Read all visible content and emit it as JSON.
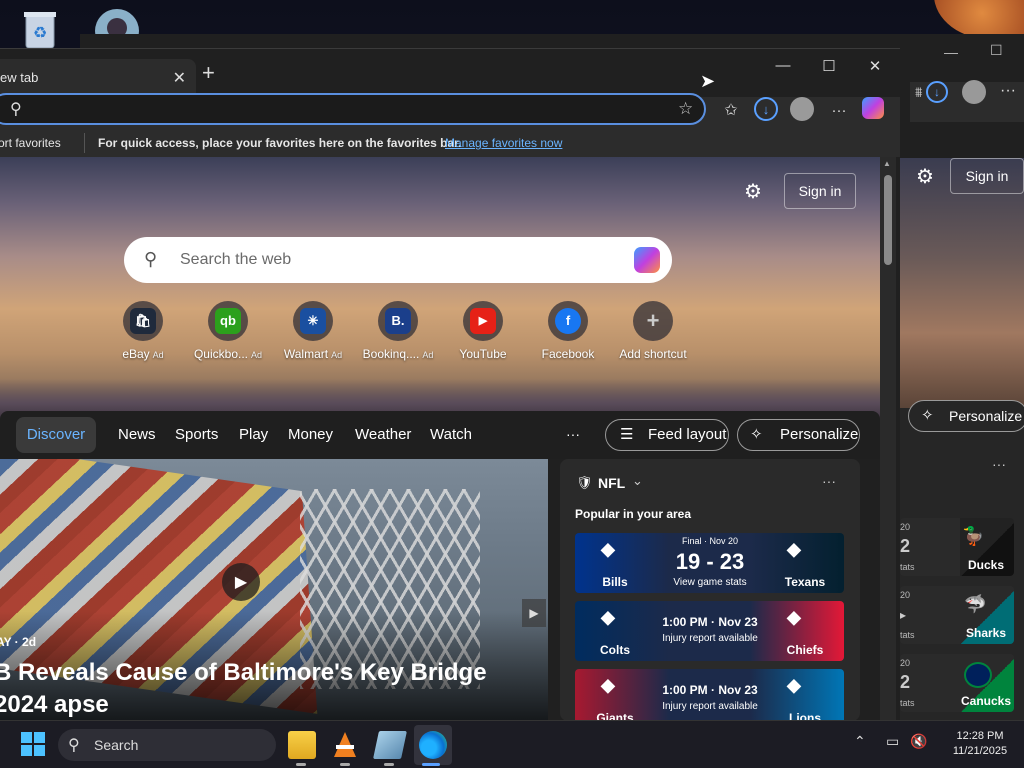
{
  "desktop": {
    "icons": [
      "recycle-bin-icon",
      "user-avatar-icon"
    ]
  },
  "background_window": {
    "signin_label": "Sign in",
    "personalize_label": "Personalize",
    "games": [
      {
        "team": "Ducks",
        "partial_top": "20",
        "partial_mid": "2",
        "partial_bottom": "tats"
      },
      {
        "team": "Sharks",
        "partial_top": "20",
        "partial_mid": "▸",
        "partial_bottom": "tats"
      },
      {
        "team": "Canucks",
        "partial_top": "20",
        "partial_mid": "2",
        "partial_bottom": "tats"
      }
    ]
  },
  "browser": {
    "tab_title": "ew tab",
    "fav_left": "ort favorites",
    "favbar_message": "For quick access, place your favorites here on the favorites bar.",
    "favbar_link": "Manage favorites now",
    "address_value": "",
    "window_controls": {
      "minimize": "—",
      "maximize": "☐",
      "close": "✕"
    }
  },
  "hero": {
    "signin_label": "Sign in",
    "search_placeholder": "Search the web"
  },
  "shortcuts": [
    {
      "label": "eBay",
      "ad": "Ad",
      "icon": "ebay-icon",
      "glyph": "🛍",
      "color": "#1f2a3c"
    },
    {
      "label": "Quickbo...",
      "ad": "Ad",
      "icon": "quickbooks-icon",
      "glyph": "qb",
      "color": "#2ca01c"
    },
    {
      "label": "Walmart",
      "ad": "Ad",
      "icon": "walmart-icon",
      "glyph": "✳",
      "color": "#1a4fa0"
    },
    {
      "label": "Bookinq....",
      "ad": "Ad",
      "icon": "booking-icon",
      "glyph": "B.",
      "color": "#1b3f8b"
    },
    {
      "label": "YouTube",
      "ad": "",
      "icon": "youtube-icon",
      "glyph": "▶",
      "color": "#e62117"
    },
    {
      "label": "Facebook",
      "ad": "",
      "icon": "facebook-icon",
      "glyph": "f",
      "color": "#1877f2"
    },
    {
      "label": "Add shortcut",
      "ad": "",
      "icon": "plus-icon",
      "glyph": "+",
      "color": "#555"
    }
  ],
  "nav": {
    "items": [
      "Discover",
      "News",
      "Sports",
      "Play",
      "Money",
      "Weather",
      "Watch"
    ],
    "more": "···",
    "feed_layout": "Feed layout",
    "personalize": "Personalize"
  },
  "feed": {
    "meta": "AY · 2d",
    "headline": "B Reveals Cause of Baltimore's Key Bridge 2024 apse"
  },
  "nfl": {
    "title": "NFL",
    "subtitle": "Popular in your area",
    "more": "···",
    "games": [
      {
        "away": "Bills",
        "home": "Texans",
        "top": "Final · Nov 20",
        "score": "19 - 23",
        "bottom": "View game stats",
        "away_color": "#00338d",
        "home_color": "#03202f"
      },
      {
        "away": "Colts",
        "home": "Chiefs",
        "top": "",
        "score": "1:00 PM · Nov 23",
        "bottom": "Injury report available",
        "away_color": "#002c5f",
        "home_color": "#e31837"
      },
      {
        "away": "Giants",
        "home": "Lions",
        "top": "",
        "score": "1:00 PM · Nov 23",
        "bottom": "Injury report available",
        "away_color": "#a71930",
        "home_color": "#0076b6"
      }
    ]
  },
  "taskbar": {
    "search_label": "Search",
    "time": "12:28 PM",
    "date": "11/21/2025"
  }
}
